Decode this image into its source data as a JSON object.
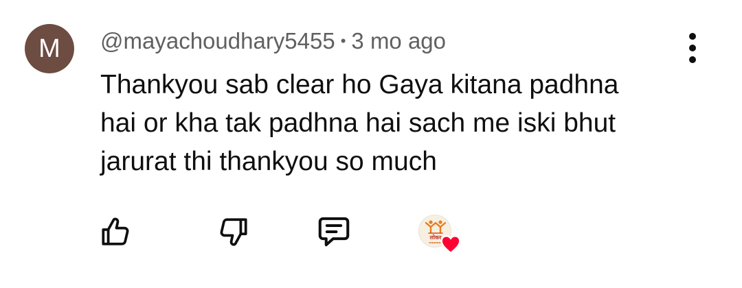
{
  "comment": {
    "avatar_letter": "M",
    "avatar_color": "#6d4c41",
    "author": "@mayachoudhary5455",
    "separator": "•",
    "time": "3 mo ago",
    "text_lines": [
      "Thankyou sab clear ho Gaya kitana padhna",
      "hai or kha tak padhna hai sach me iski bhut",
      "jarurat thi thankyou so much"
    ]
  },
  "actions": {
    "like_icon": "thumbs-up-icon",
    "dislike_icon": "thumbs-down-icon",
    "reply_icon": "comment-icon",
    "creator_heart_icon": "heart-icon",
    "heart_color": "#ff0033",
    "more_icon": "more-vertical-icon"
  },
  "creator_avatar": {
    "logo_text": "लोकर"
  }
}
